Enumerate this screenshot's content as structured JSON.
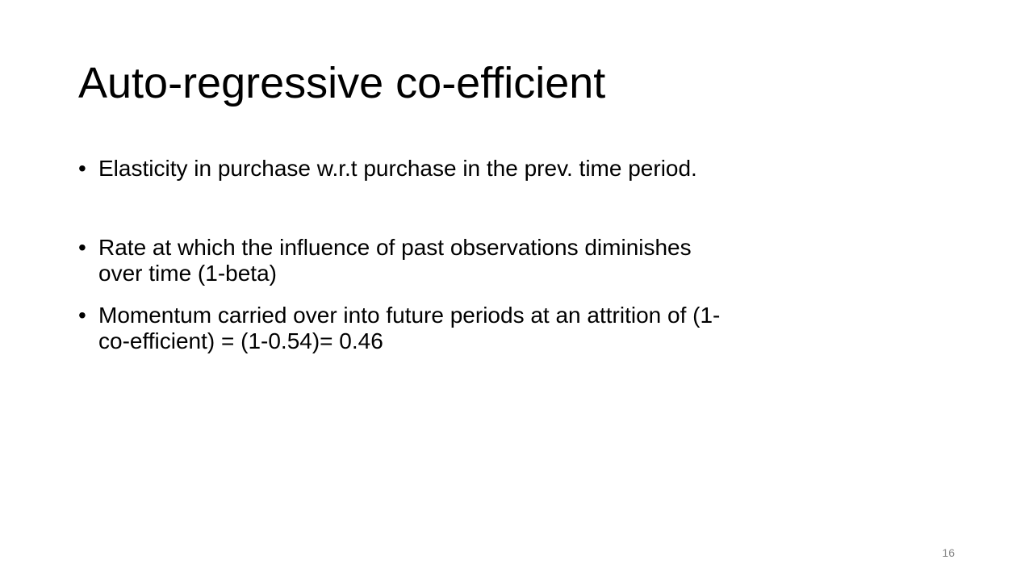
{
  "slide": {
    "title": "Auto-regressive co-efficient",
    "bullet_glyph": "•",
    "bullets": [
      {
        "lines": [
          "Elasticity in purchase w.r.t purchase in the prev. time period."
        ]
      },
      {
        "lines": [
          "Rate at which the influence of past observations diminishes",
          "over time (1-beta)"
        ]
      },
      {
        "lines": [
          "Momentum carried over into future periods at an attrition of (1-",
          "co-efficient) = (1-0.54)= 0.46"
        ]
      }
    ],
    "page_number": "16"
  }
}
